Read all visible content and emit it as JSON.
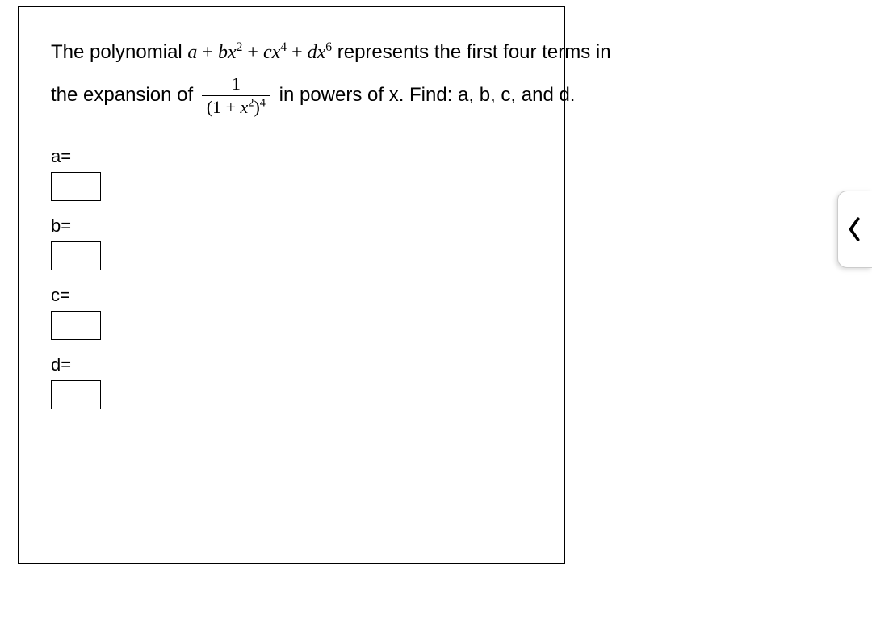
{
  "question": {
    "line1_prefix": "The polynomial ",
    "poly_a": "a",
    "plus1": " + ",
    "poly_b": "b",
    "poly_x2_base": "x",
    "poly_x2_exp": "2",
    "plus2": " + ",
    "poly_c": "c",
    "poly_x4_base": "x",
    "poly_x4_exp": "4",
    "plus3": " + ",
    "poly_d": "d",
    "poly_x6_base": "x",
    "poly_x6_exp": "6",
    "line1_suffix": "  represents the first four terms in",
    "line2_prefix": "the expansion of ",
    "frac_num": "1",
    "frac_den_open": "(1 + ",
    "frac_den_x": "x",
    "frac_den_exp2": "2",
    "frac_den_close": ")",
    "frac_den_exp4": "4",
    "line2_suffix": " in powers of x. Find: a, b, c, and d."
  },
  "answers": {
    "a_label": "a=",
    "b_label": "b=",
    "c_label": "c=",
    "d_label": "d=",
    "a_value": "",
    "b_value": "",
    "c_value": "",
    "d_value": ""
  }
}
